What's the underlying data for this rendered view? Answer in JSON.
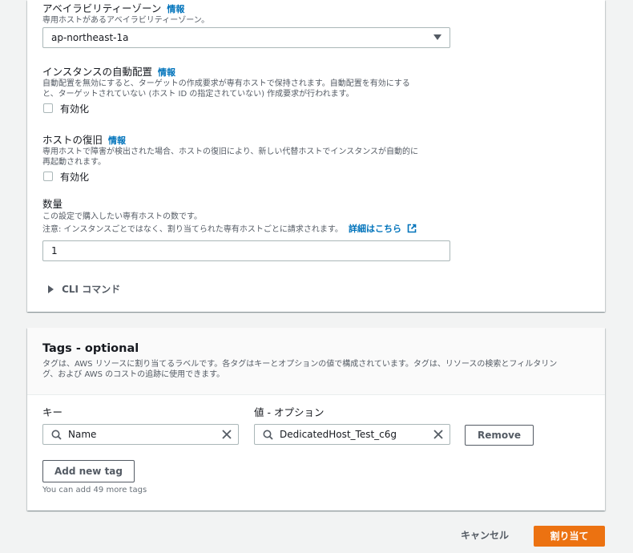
{
  "az": {
    "label": "アベイラビリティーゾーン",
    "info": "情報",
    "description": "専用ホストがあるアベイラビリティーゾーン。",
    "value": "ap-northeast-1a"
  },
  "auto_placement": {
    "label": "インスタンスの自動配置",
    "info": "情報",
    "description_line1": "自動配置を無効にすると、ターゲットの作成要求が専有ホストで保持されます。自動配置を有効にする",
    "description_line2": "と、ターゲットされていない (ホスト ID の指定されていない) 作成要求が行われます。",
    "checkbox_label": "有効化"
  },
  "host_recovery": {
    "label": "ホストの復旧",
    "info": "情報",
    "description_line1": "専用ホストで障害が検出された場合、ホストの復旧により、新しい代替ホストでインスタンスが自動的に",
    "description_line2": "再起動されます。",
    "checkbox_label": "有効化"
  },
  "quantity": {
    "label": "数量",
    "description_line1": "この設定で購入したい専有ホストの数です。",
    "description_line2": "注意: インスタンスごとではなく、割り当てられた専有ホストごとに請求されます。",
    "details_link": "詳細はこちら",
    "value": "1"
  },
  "cli": {
    "label": "CLI コマンド"
  },
  "tags": {
    "title": "Tags - optional",
    "description_line1": "タグは、AWS リソースに割り当てるラベルです。各タグはキーとオプションの値で構成されています。タグは、リソースの検索とフィルタリン",
    "description_line2": "グ、および AWS のコストの追跡に使用できます。",
    "key_header": "キー",
    "value_header": "値 - オプション",
    "rows": [
      {
        "key": "Name",
        "value": "DedicatedHost_Test_c6g"
      }
    ],
    "remove_label": "Remove",
    "add_label": "Add new tag",
    "remaining_text": "You can add 49 more tags"
  },
  "footer": {
    "cancel_label": "キャンセル",
    "submit_label": "割り当て"
  }
}
